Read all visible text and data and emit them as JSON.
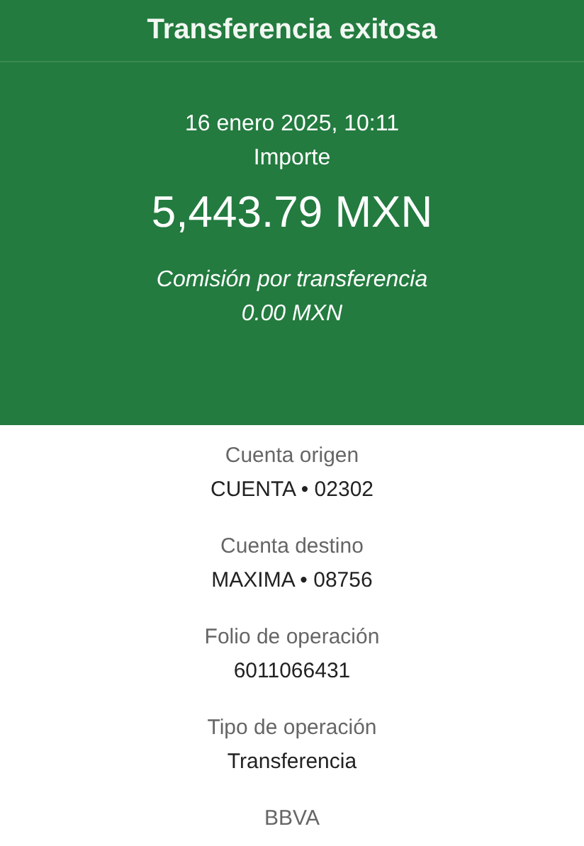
{
  "header": {
    "title": "Transferencia exitosa"
  },
  "summary": {
    "datetime": "16 enero 2025, 10:11",
    "amount_label": "Importe",
    "amount": "5,443.79 MXN",
    "fee_label": "Comisión por transferencia",
    "fee": "0.00 MXN"
  },
  "details": [
    {
      "label": "Cuenta origen",
      "value": "CUENTA • 02302"
    },
    {
      "label": "Cuenta destino",
      "value": "MAXIMA • 08756"
    },
    {
      "label": "Folio de operación",
      "value": "6011066431"
    },
    {
      "label": "Tipo de operación",
      "value": "Transferencia"
    }
  ],
  "bank": "BBVA"
}
